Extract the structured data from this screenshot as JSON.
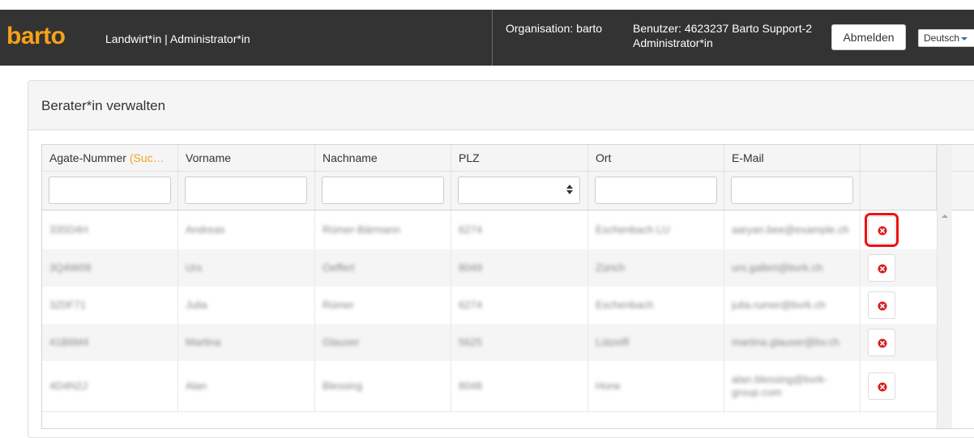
{
  "app": {
    "brand": "barto",
    "roles": "Landwirt*in  |  Administrator*in",
    "organisation": "Organisation: barto",
    "user_line1": "Benutzer: 4623237 Barto Support-2",
    "user_line2": "Administrator*in",
    "logout_label": "Abmelden",
    "language": "Deutsch"
  },
  "panel": {
    "title": "Berater*in verwalten"
  },
  "table": {
    "columns": [
      {
        "label": "Agate-Nummer",
        "suffix": "(Suc…"
      },
      {
        "label": "Vorname"
      },
      {
        "label": "Nachname"
      },
      {
        "label": "PLZ"
      },
      {
        "label": "Ort"
      },
      {
        "label": "E-Mail"
      }
    ],
    "rows": [
      {
        "agate": "335D4H",
        "vorname": "Andreas",
        "nachname": "Rümer-Bärmann",
        "plz": "6274",
        "ort": "Eschenbach LU",
        "email": "aaryan.bee@example.ch"
      },
      {
        "agate": "3Q4W09",
        "vorname": "Urs",
        "nachname": "Oeffert",
        "plz": "8049",
        "ort": "Zürich",
        "email": "urs.gallert@bvrk.ch"
      },
      {
        "agate": "3Z0F71",
        "vorname": "Julia",
        "nachname": "Rümer",
        "plz": "6274",
        "ort": "Eschenbach",
        "email": "julia.rumer@bvrk.ch"
      },
      {
        "agate": "41B6M4",
        "vorname": "Martina",
        "nachname": "Glauser",
        "plz": "5625",
        "ort": "Lützelfl",
        "email": "martina.glauser@bv.ch"
      },
      {
        "agate": "4D4N2J",
        "vorname": "Alan",
        "nachname": "Blessing",
        "plz": "8048",
        "ort": "Horw",
        "email": "alan.blessing@bvrk-group.com"
      }
    ]
  },
  "colors": {
    "navbar": "#333333",
    "brand": "#f7a11a",
    "accent_orange": "#f7a11a",
    "delete_icon": "#dd1a1a",
    "highlight": "#ee1111"
  },
  "icons": {
    "delete": "x-circle-icon",
    "sort_spinner": "spinner-arrows-icon",
    "caret": "caret-down-icon"
  }
}
